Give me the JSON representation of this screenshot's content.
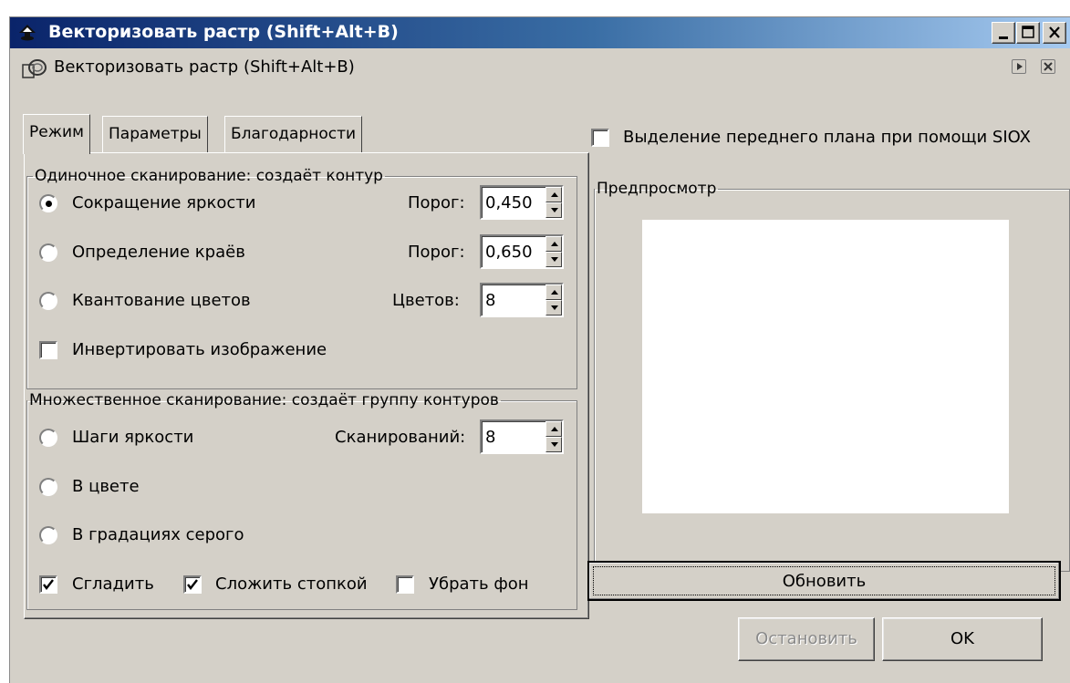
{
  "window": {
    "title": "Векторизовать растр (Shift+Alt+B)",
    "dock_title": "Векторизовать растр (Shift+Alt+B)"
  },
  "tabs": [
    {
      "label": "Режим",
      "active": true
    },
    {
      "label": "Параметры",
      "active": false
    },
    {
      "label": "Благодарности",
      "active": false
    }
  ],
  "single_scan": {
    "legend": "Одиночное сканирование: создаёт контур",
    "options": [
      {
        "label": "Сокращение яркости",
        "selected": true,
        "param_label": "Порог:",
        "param_value": "0,450"
      },
      {
        "label": "Определение краёв",
        "selected": false,
        "param_label": "Порог:",
        "param_value": "0,650"
      },
      {
        "label": "Квантование цветов",
        "selected": false,
        "param_label": "Цветов:",
        "param_value": "8"
      }
    ],
    "invert": {
      "label": "Инвертировать изображение",
      "checked": false
    }
  },
  "multi_scan": {
    "legend": "Множественное сканирование: создаёт группу контуров",
    "options": [
      {
        "label": "Шаги яркости",
        "selected": false,
        "param_label": "Сканирований:",
        "param_value": "8"
      },
      {
        "label": "В цвете",
        "selected": false
      },
      {
        "label": "В градациях серого",
        "selected": false
      }
    ],
    "checks": [
      {
        "label": "Сгладить",
        "checked": true
      },
      {
        "label": "Сложить стопкой",
        "checked": true
      },
      {
        "label": "Убрать фон",
        "checked": false
      }
    ]
  },
  "siox": {
    "label": "Выделение переднего плана при помощи SIOX",
    "checked": false
  },
  "preview": {
    "legend": "Предпросмотр",
    "update_label": "Обновить"
  },
  "buttons": {
    "stop_label": "Остановить",
    "ok_label": "OK"
  },
  "colors": {
    "dialog_bg": "#d4d0c8",
    "title_start": "#0a246a",
    "title_end": "#a6caf0"
  }
}
